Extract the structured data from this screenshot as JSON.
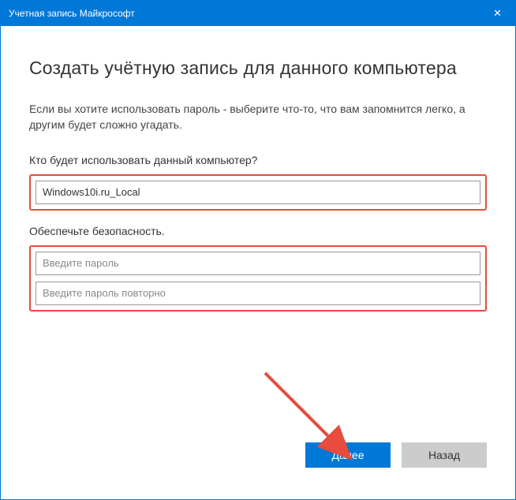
{
  "titlebar": {
    "title": "Учетная запись Майкрософт",
    "close_label": "✕"
  },
  "heading": "Создать учётную запись для данного компьютера",
  "description": "Если вы хотите использовать пароль - выберите что-то, что вам запомнится легко, а другим будет сложно угадать.",
  "username_section": {
    "label": "Кто будет использовать данный компьютер?",
    "value": "Windows10i.ru_Local"
  },
  "password_section": {
    "label": "Обеспечьте безопасность.",
    "placeholder_password": "Введите пароль",
    "placeholder_confirm": "Введите пароль повторно"
  },
  "footer": {
    "next_label": "Далее",
    "back_label": "Назад"
  }
}
